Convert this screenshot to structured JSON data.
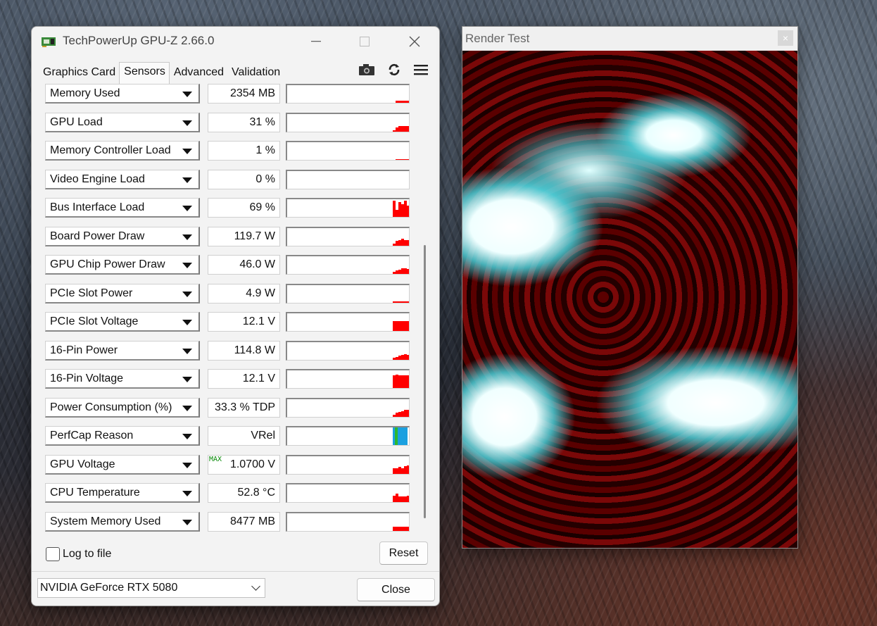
{
  "gpuz": {
    "title": "TechPowerUp GPU-Z 2.66.0",
    "tabs": [
      "Graphics Card",
      "Sensors",
      "Advanced",
      "Validation"
    ],
    "active_tab": "Sensors",
    "sensors": [
      {
        "name": "Memory Used",
        "value": "2354 MB",
        "graph": [
          0,
          0,
          0,
          0,
          0,
          0,
          0,
          0,
          0,
          0,
          0,
          0,
          0,
          0,
          0,
          0,
          0,
          0,
          0,
          0,
          0,
          0,
          0.12,
          0.12,
          0.12,
          0.12,
          0.12
        ]
      },
      {
        "name": "GPU Load",
        "value": "31 %",
        "graph": [
          0,
          0,
          0,
          0,
          0,
          0,
          0,
          0,
          0,
          0,
          0,
          0,
          0,
          0,
          0,
          0,
          0,
          0,
          0,
          0,
          0,
          0.05,
          0.2,
          0.3,
          0.3,
          0.3,
          0.3
        ]
      },
      {
        "name": "Memory Controller Load",
        "value": "1 %",
        "graph": [
          0,
          0,
          0,
          0,
          0,
          0,
          0,
          0,
          0,
          0,
          0,
          0,
          0,
          0,
          0,
          0,
          0,
          0,
          0,
          0,
          0,
          0,
          0.05,
          0.05,
          0.04,
          0.05,
          0.02
        ]
      },
      {
        "name": "Video Engine Load",
        "value": "0 %",
        "graph": []
      },
      {
        "name": "Bus Interface Load",
        "value": "69 %",
        "graph": [
          0,
          0,
          0,
          0,
          0,
          0,
          0,
          0,
          0,
          0,
          0,
          0,
          0,
          0,
          0,
          0,
          0,
          0,
          0,
          0,
          0,
          0.9,
          0.4,
          0.8,
          0.7,
          0.9,
          0.6
        ]
      },
      {
        "name": "Board Power Draw",
        "value": "119.7 W",
        "graph": [
          0,
          0,
          0,
          0,
          0,
          0,
          0,
          0,
          0,
          0,
          0,
          0,
          0,
          0,
          0,
          0,
          0,
          0,
          0,
          0,
          0,
          0.1,
          0.25,
          0.3,
          0.35,
          0.3,
          0.3
        ]
      },
      {
        "name": "GPU Chip Power Draw",
        "value": "46.0 W",
        "graph": [
          0,
          0,
          0,
          0,
          0,
          0,
          0,
          0,
          0,
          0,
          0,
          0,
          0,
          0,
          0,
          0,
          0,
          0,
          0,
          0,
          0,
          0.1,
          0.2,
          0.25,
          0.3,
          0.3,
          0.28
        ]
      },
      {
        "name": "PCIe Slot Power",
        "value": "4.9 W",
        "graph": [
          0,
          0,
          0,
          0,
          0,
          0,
          0,
          0,
          0,
          0,
          0,
          0,
          0,
          0,
          0,
          0,
          0,
          0,
          0,
          0,
          0,
          0.05,
          0.05,
          0.05,
          0.05,
          0.05,
          0.05
        ]
      },
      {
        "name": "PCIe Slot Voltage",
        "value": "12.1 V",
        "graph": [
          0,
          0,
          0,
          0,
          0,
          0,
          0,
          0,
          0,
          0,
          0,
          0,
          0,
          0,
          0,
          0,
          0,
          0,
          0,
          0,
          0,
          0.55,
          0.55,
          0.55,
          0.55,
          0.55,
          0.55
        ]
      },
      {
        "name": "16-Pin Power",
        "value": "114.8 W",
        "graph": [
          0,
          0,
          0,
          0,
          0,
          0,
          0,
          0,
          0,
          0,
          0,
          0,
          0,
          0,
          0,
          0,
          0,
          0,
          0,
          0,
          0,
          0.1,
          0.15,
          0.2,
          0.25,
          0.3,
          0.25
        ]
      },
      {
        "name": "16-Pin Voltage",
        "value": "12.1 V",
        "graph": [
          0,
          0,
          0,
          0,
          0,
          0,
          0,
          0,
          0,
          0,
          0,
          0,
          0,
          0,
          0,
          0,
          0,
          0,
          0,
          0,
          0,
          0.7,
          0.75,
          0.7,
          0.7,
          0.7,
          0.7
        ]
      },
      {
        "name": "Power Consumption (%)",
        "value": "33.3 % TDP",
        "graph": [
          0,
          0,
          0,
          0,
          0,
          0,
          0,
          0,
          0,
          0,
          0,
          0,
          0,
          0,
          0,
          0,
          0,
          0,
          0,
          0,
          0,
          0.1,
          0.2,
          0.25,
          0.3,
          0.35,
          0.35
        ]
      },
      {
        "name": "PerfCap Reason",
        "value": "VRel",
        "graph": [],
        "perfcap": true
      },
      {
        "name": "GPU Voltage",
        "value": "1.0700 V",
        "max": "MAX",
        "graph": [
          0,
          0,
          0,
          0,
          0,
          0,
          0,
          0,
          0,
          0,
          0,
          0,
          0,
          0,
          0,
          0,
          0,
          0,
          0,
          0,
          0,
          0.3,
          0.3,
          0.35,
          0.3,
          0.4,
          0.45
        ]
      },
      {
        "name": "CPU Temperature",
        "value": "52.8 °C",
        "graph": [
          0,
          0,
          0,
          0,
          0,
          0,
          0,
          0,
          0,
          0,
          0,
          0,
          0,
          0,
          0,
          0,
          0,
          0,
          0,
          0,
          0,
          0.35,
          0.45,
          0.3,
          0.3,
          0.3,
          0.35
        ]
      },
      {
        "name": "System Memory Used",
        "value": "8477 MB",
        "graph": [
          0,
          0,
          0,
          0,
          0,
          0,
          0,
          0,
          0,
          0,
          0,
          0,
          0,
          0,
          0,
          0,
          0,
          0,
          0,
          0,
          0,
          0.2,
          0.2,
          0.2,
          0.2,
          0.2,
          0.2
        ]
      }
    ],
    "log_label": "Log to file",
    "reset_label": "Reset",
    "gpu_select": "NVIDIA GeForce RTX 5080",
    "close_label": "Close",
    "graph_color": "#ff0000"
  },
  "render": {
    "title": "Render Test",
    "close_glyph": "×"
  }
}
